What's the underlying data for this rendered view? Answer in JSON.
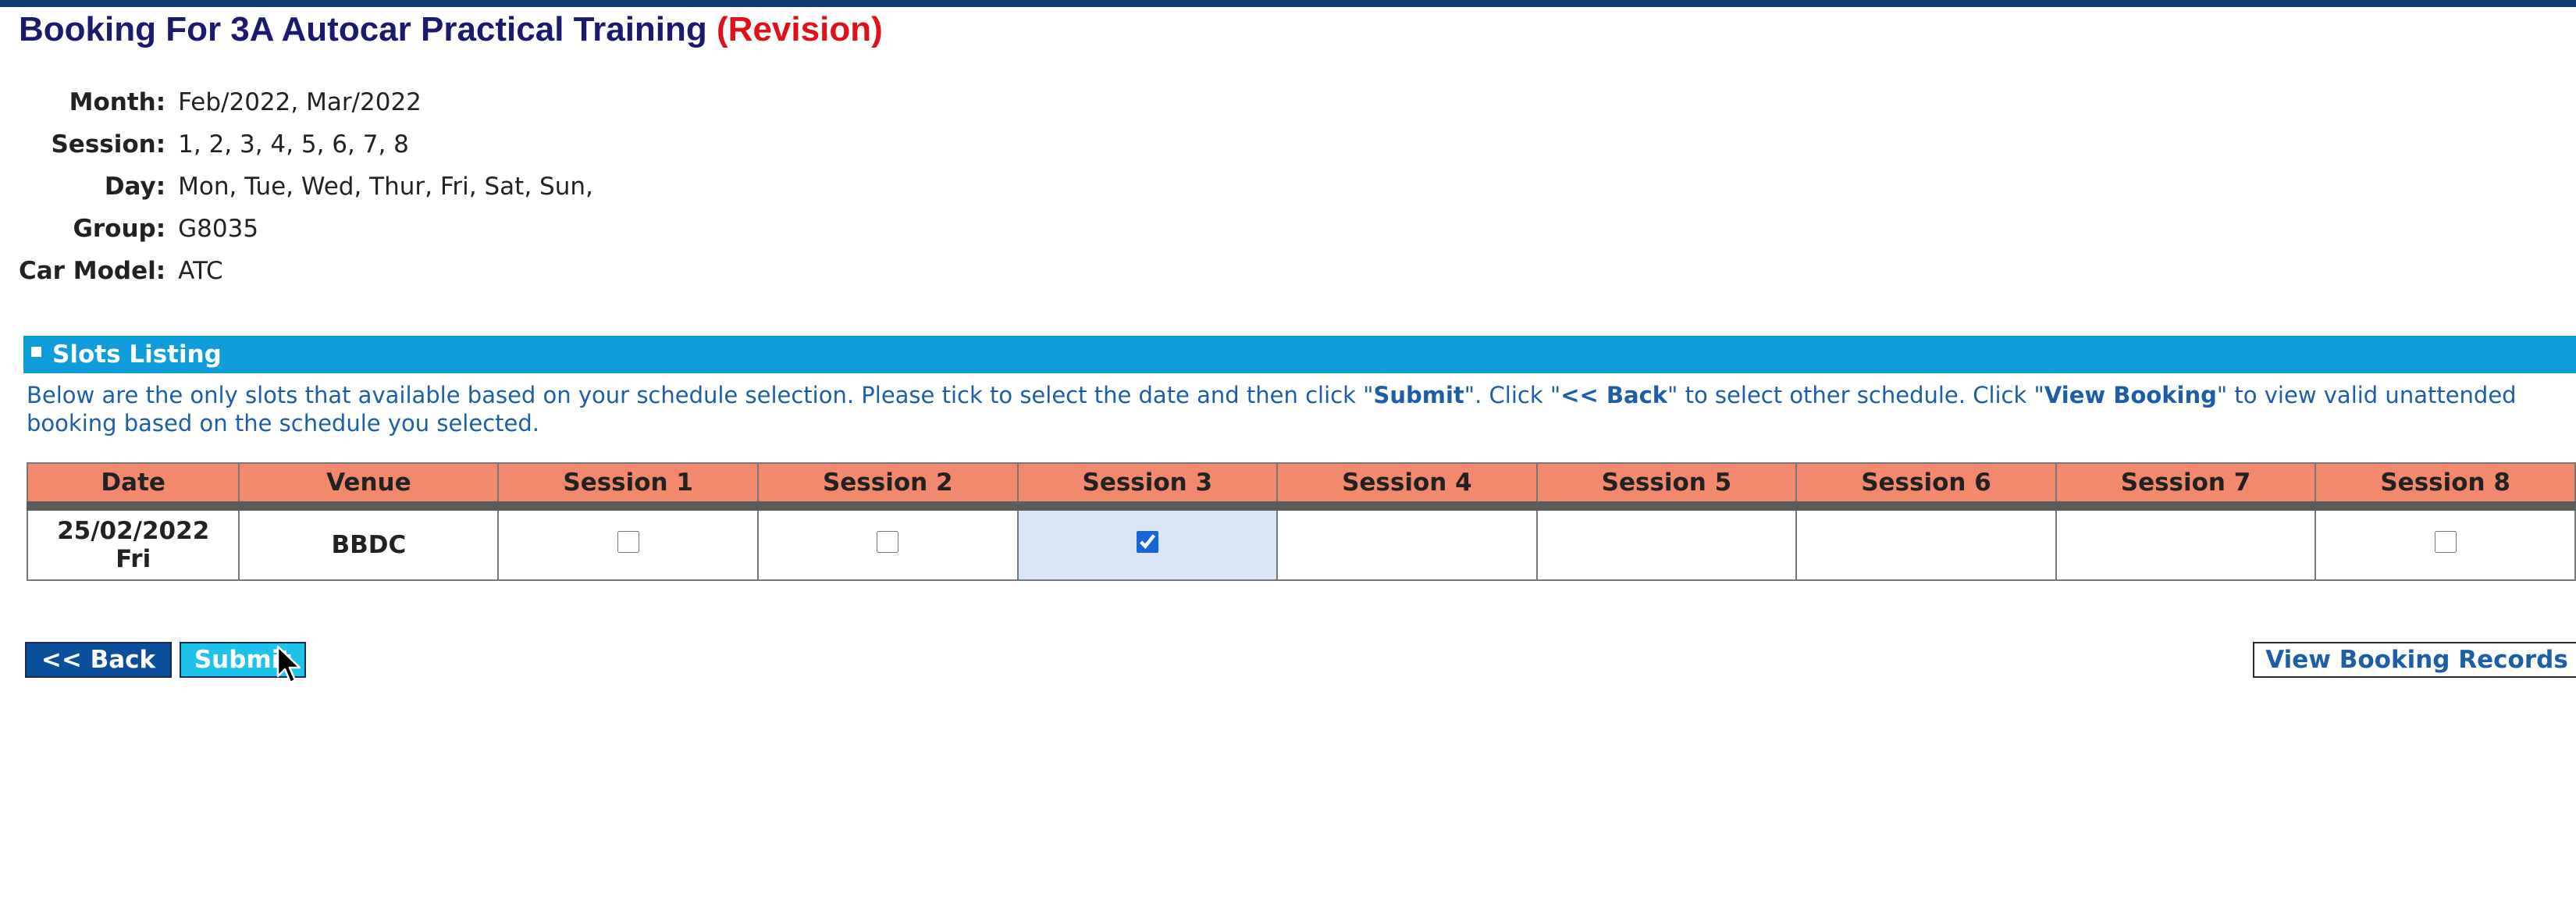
{
  "header": {
    "title_main": "Booking For 3A Autocar Practical Training",
    "title_revision": "(Revision)"
  },
  "info": [
    {
      "label": "Month:",
      "value": "Feb/2022, Mar/2022"
    },
    {
      "label": "Session:",
      "value": "1, 2, 3, 4, 5, 6, 7, 8"
    },
    {
      "label": "Day:",
      "value": "Mon, Tue, Wed, Thur, Fri, Sat, Sun,"
    },
    {
      "label": "Group:",
      "value": "G8035"
    },
    {
      "label": "Car Model:",
      "value": "ATC"
    }
  ],
  "slots_section": {
    "title": "Slots Listing",
    "instructions": [
      "Below are the only slots that available based on your schedule selection. Please tick to select the date and then click \"",
      "Submit",
      "\". Click \"",
      "<< Back",
      "\" to select other schedule. Click \"",
      "View Booking",
      "\" to view valid unattended booking based on the schedule you selected."
    ]
  },
  "table": {
    "headers": [
      "Date",
      "Venue",
      "Session 1",
      "Session 2",
      "Session 3",
      "Session 4",
      "Session 5",
      "Session 6",
      "Session 7",
      "Session 8"
    ],
    "rows": [
      {
        "date": "25/02/2022",
        "weekday": "Fri",
        "venue": "BBDC",
        "sessions": [
          {
            "available": true,
            "checked": false
          },
          {
            "available": true,
            "checked": false
          },
          {
            "available": true,
            "checked": true
          },
          {
            "available": false,
            "checked": false
          },
          {
            "available": false,
            "checked": false
          },
          {
            "available": false,
            "checked": false
          },
          {
            "available": false,
            "checked": false
          },
          {
            "available": true,
            "checked": false
          }
        ]
      }
    ]
  },
  "buttons": {
    "back": "<< Back",
    "submit": "Submit",
    "view_records": "View Booking Records"
  },
  "colors": {
    "title": "#1a1a6e",
    "revision": "#e0101b",
    "section_bar": "#0e9cdb",
    "table_header": "#f2896d",
    "selected_cell": "#d8e6f5",
    "link_text": "#1c5ea8"
  }
}
